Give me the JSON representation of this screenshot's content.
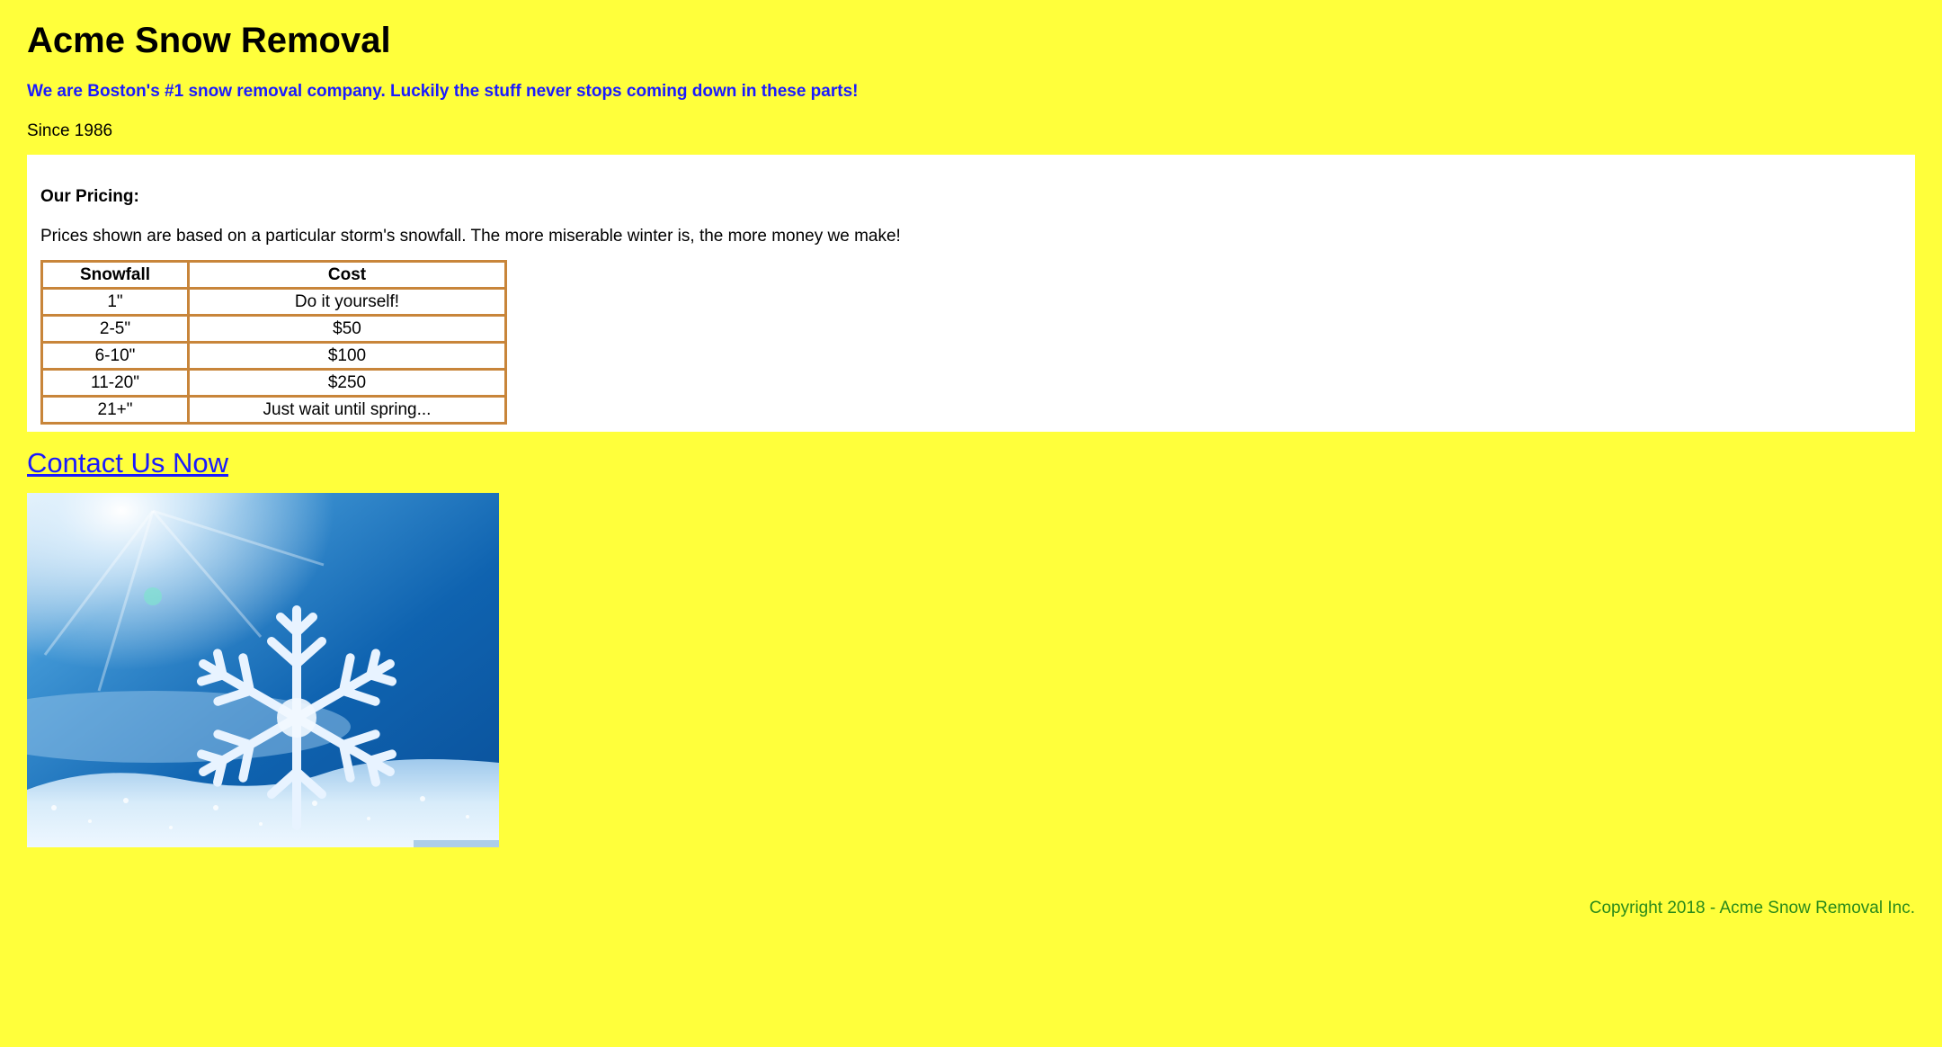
{
  "header": {
    "title": "Acme Snow Removal",
    "tagline": "We are Boston's #1 snow removal company. Luckily the stuff never stops coming down in these parts!",
    "since": "Since 1986"
  },
  "pricing": {
    "title": "Our Pricing:",
    "description": "Prices shown are based on a particular storm's snowfall. The more miserable winter is, the more money we make!",
    "columns": [
      "Snowfall",
      "Cost"
    ],
    "rows": [
      [
        "1\"",
        "Do it yourself!"
      ],
      [
        "2-5\"",
        "$50"
      ],
      [
        "6-10\"",
        "$100"
      ],
      [
        "11-20\"",
        "$250"
      ],
      [
        "21+\"",
        "Just wait until spring..."
      ]
    ]
  },
  "contact": {
    "label": "Contact Us Now"
  },
  "image": {
    "subject": "snowflake-photo"
  },
  "footer": {
    "copyright": "Copyright 2018 - Acme Snow Removal Inc."
  },
  "colors": {
    "background": "#ffff3b",
    "tagline": "#1a1aff",
    "link": "#1a1aff",
    "table_border": "#c8853a",
    "copyright": "#2a8a1a"
  }
}
